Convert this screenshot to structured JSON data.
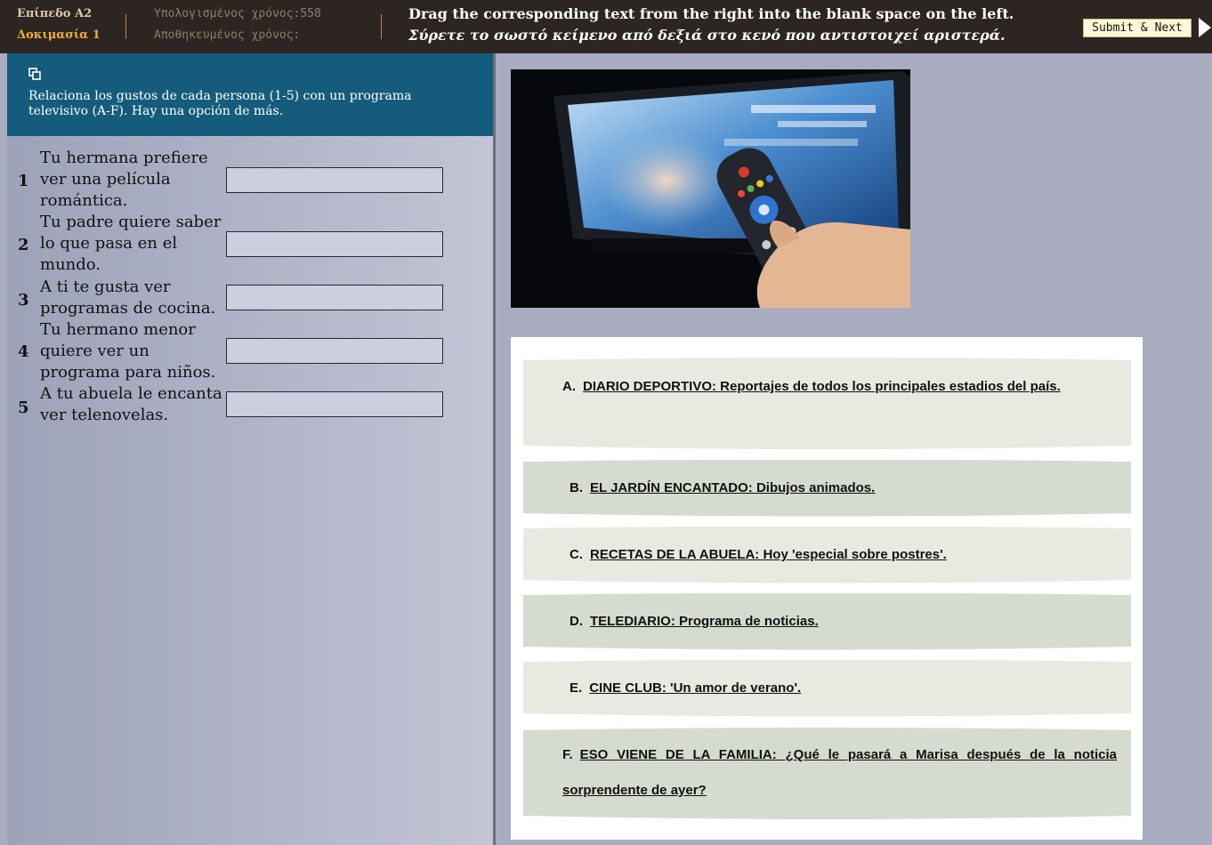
{
  "header": {
    "level": "Επίπεδο Α2",
    "task": "Δοκιμασία 1",
    "calculated_time": "Υπολογισμένος χρόνος:558",
    "saved_time": "Αποθηκευμένος χρόνος:",
    "instruction_en": "Drag the corresponding text from the right into the blank space on the left.",
    "instruction_el": "Σύρετε το σωστό κείμενο από δεξιά στο κενό που αντιστοιχεί αριστερά.",
    "submit_label": "Submit & Next"
  },
  "left_panel": {
    "copy_icon": "copy-icon",
    "prompt": "Relaciona los gustos de cada persona (1-5) con un programa televisivo (A-F). Hay una opción de más.",
    "questions": [
      {
        "num": "1",
        "text": "Tu hermana prefiere ver una película romántica.",
        "answer": ""
      },
      {
        "num": "2",
        "text": "Tu padre quiere saber lo que pasa en el mundo.",
        "answer": ""
      },
      {
        "num": "3",
        "text": "A ti te gusta ver programas de cocina.",
        "answer": ""
      },
      {
        "num": "4",
        "text": "Tu hermano menor quiere ver un programa para niños.",
        "answer": ""
      },
      {
        "num": "5",
        "text": "A tu abuela le encanta ver telenovelas.",
        "answer": ""
      }
    ]
  },
  "image": {
    "subject": "tv-remote-photo"
  },
  "options": [
    {
      "letter": "A.",
      "text": "DIARIO DEPORTIVO: Reportajes de todos los principales estadios del país."
    },
    {
      "letter": "B.",
      "text": "EL JARDÍN ENCANTADO: Dibujos animados."
    },
    {
      "letter": "C.",
      "text": "RECETAS DE LA ABUELA: Hoy 'especial sobre postres'."
    },
    {
      "letter": "D.",
      "text": "TELEDIARIO: Programa de noticias."
    },
    {
      "letter": "E.",
      "text": "CINE CLUB: 'Un amor de verano'."
    },
    {
      "letter": "F.",
      "text": "ESO VIENE DE LA FAMILIA: ¿Qué le pasará a Marisa después de la noticia sorprendente de ayer?"
    }
  ],
  "colors": {
    "topbar": "#2d2521",
    "header_blue": "#155b7c",
    "option_light": "#e7eae0",
    "option_dark": "#d6dbd0"
  }
}
